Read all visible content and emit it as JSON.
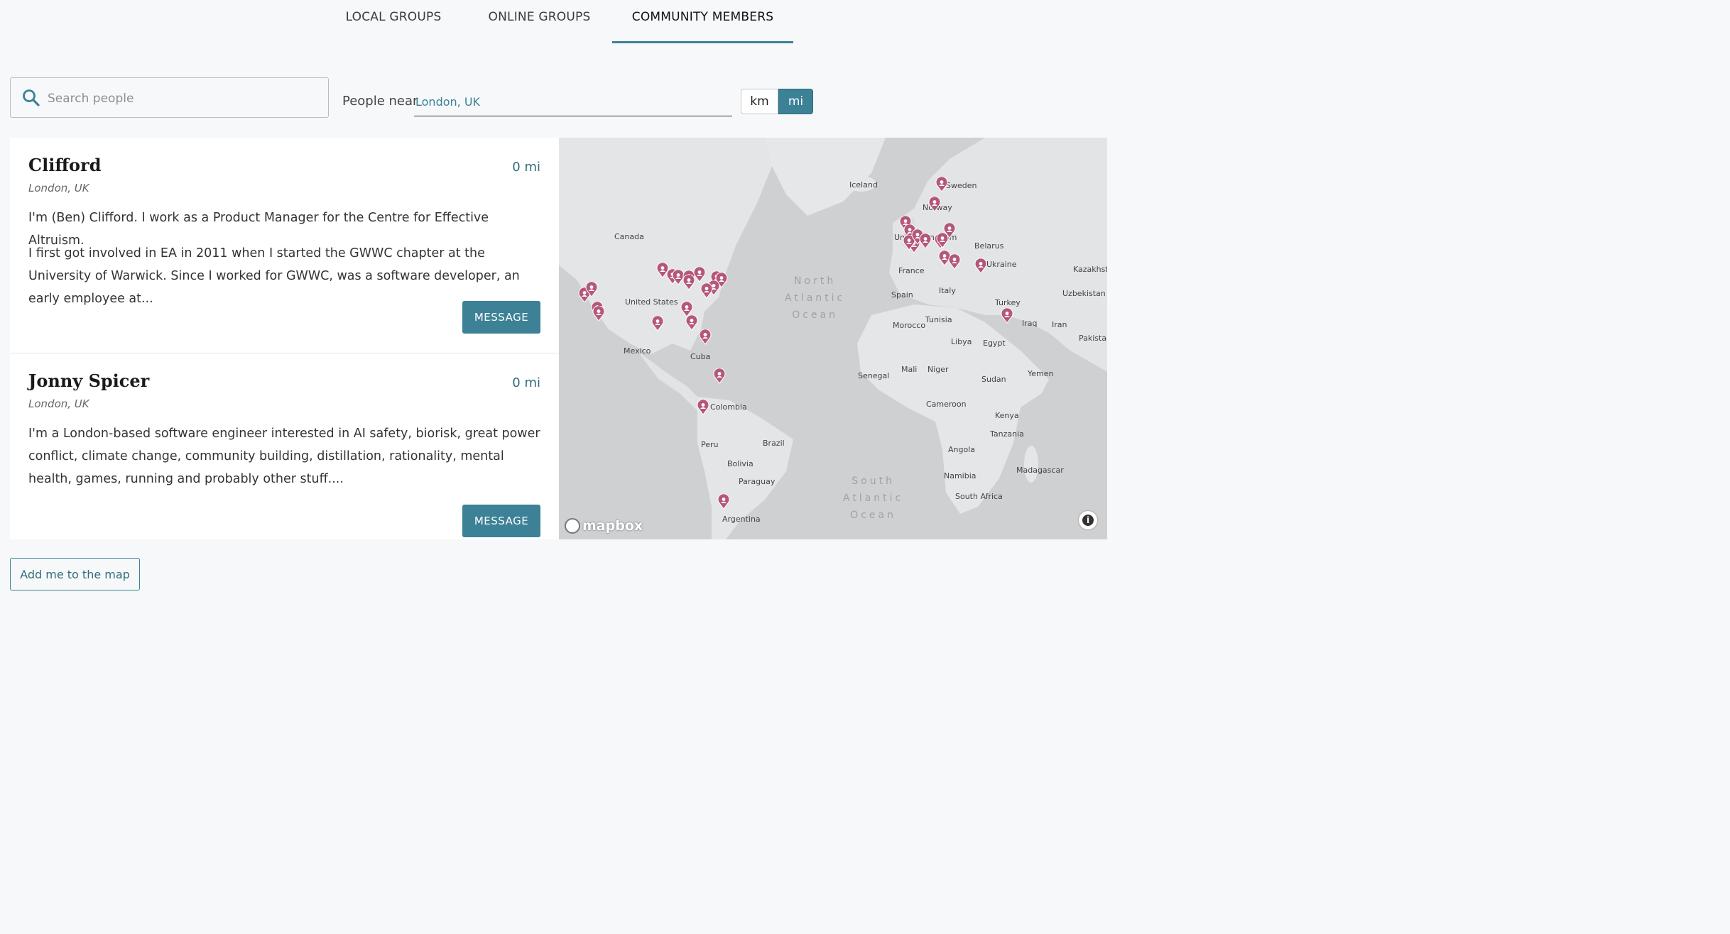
{
  "tabs": [
    {
      "label": "LOCAL GROUPS"
    },
    {
      "label": "ONLINE GROUPS"
    },
    {
      "label": "COMMUNITY MEMBERS"
    }
  ],
  "search": {
    "placeholder": "Search people"
  },
  "near": {
    "label": "People near",
    "value": "London, UK"
  },
  "units": {
    "km": "km",
    "mi": "mi",
    "selected": "mi"
  },
  "people": [
    {
      "name": "Clifford",
      "distance": "0 mi",
      "location": "London, UK",
      "bio1": "I'm (Ben) Clifford. I work as a Product Manager for the Centre for Effective Altruism.",
      "bio2": "I first got involved in EA in 2011 when I started the GWWC chapter at the University of Warwick. Since I worked for GWWC, was a software developer, an early employee at...",
      "button": "MESSAGE"
    },
    {
      "name": "Jonny Spicer",
      "distance": "0 mi",
      "location": "London, UK",
      "bio1": "I'm a London-based software engineer interested in AI safety, biorisk, great power conflict, climate change, community building, distillation, rationality, mental health, games, running and probably other stuff....",
      "button": "MESSAGE"
    }
  ],
  "map": {
    "labels": [
      "Iceland",
      "Sweden",
      "Norway",
      "Canada",
      "United Kingdom",
      "Belarus",
      "Ukraine",
      "Kazakhstan",
      "France",
      "Spain",
      "Italy",
      "Uzbekistan",
      "United States",
      "Turkey",
      "Iraq",
      "Iran",
      "Pakistan",
      "Morocco",
      "Tunisia",
      "Libya",
      "Egypt",
      "Mexico",
      "Cuba",
      "Senegal",
      "Mali",
      "Niger",
      "Sudan",
      "Yemen",
      "Cameroon",
      "Colombia",
      "Kenya",
      "Tanzania",
      "Peru",
      "Brazil",
      "Angola",
      "Bolivia",
      "Paraguay",
      "Namibia",
      "Madagascar",
      "South Africa",
      "Argentina"
    ],
    "oceans": [
      "North\nAtlantic\nOcean",
      "South\nAtlantic\nOcean"
    ],
    "attribution": "mapbox",
    "pin_color": "#b5577a"
  },
  "add_button": "Add me to the map"
}
